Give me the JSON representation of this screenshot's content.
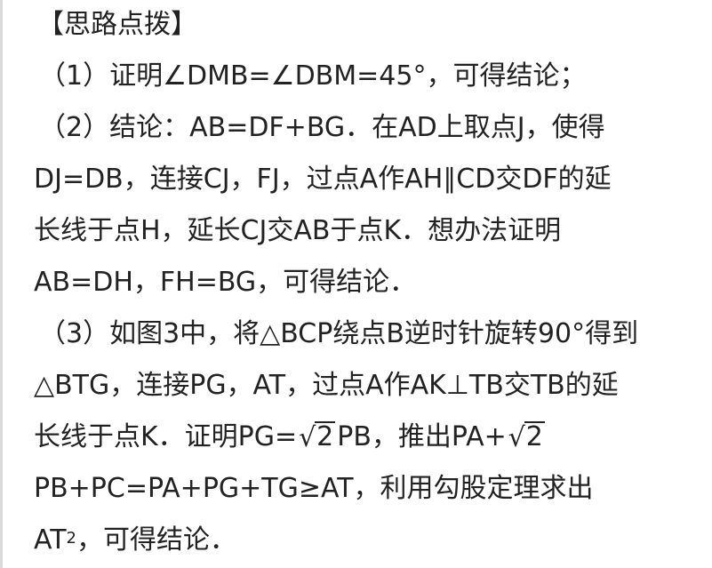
{
  "heading": "【思路点拨】",
  "lines": [
    "（1）证明∠DMB=∠DBM=45°，可得结论；",
    "（2）结论：AB=DF+BG．在AD上取点J，使得",
    "DJ=DB，连接CJ，FJ，过点A作AH∥CD交DF的延",
    "长线于点H，延长CJ交AB于点K．想办法证明",
    "AB=DH，FH=BG，可得结论．",
    "（3）如图3中，将△BCP绕点B逆时针旋转90°得到",
    "△BTG，连接PG，AT，过点A作AK⊥TB交TB的延"
  ],
  "line_pg": {
    "before": "长线于点K．证明PG=",
    "radicand": "2",
    "after": "PB，推出PA+"
  },
  "sqrt_symbol": "√",
  "line_pb": "PB+PC=PA+PG+TG≥AT，利用勾股定理求出",
  "last_line": {
    "before": "AT",
    "sup": "2",
    "after": "，可得结论．"
  }
}
